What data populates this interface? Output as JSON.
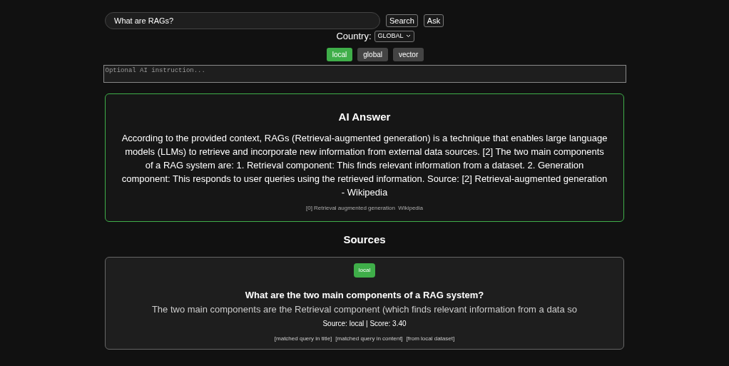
{
  "search": {
    "value": "What are RAGs?"
  },
  "buttons": [
    "Search",
    "Ask"
  ],
  "country": {
    "label": "Country:",
    "value": "GLOBAL"
  },
  "modes": [
    {
      "label": "local",
      "selected": true
    },
    {
      "label": "global",
      "selected": false
    },
    {
      "label": "vector",
      "selected": false
    }
  ],
  "instruction": {
    "placeholder": "Optional AI instruction..."
  },
  "answer": {
    "title": "AI Answer",
    "text": "According to the provided context, RAGs (Retrieval-augmented generation) is a technique that enables large language models (LLMs) to retrieve and incorporate new information from external data sources. [2] The two main components of a RAG system are: 1. Retrieval component: This finds relevant information from a dataset. 2. Generation component: This responds to user queries using the retrieved information. Source: [2] Retrieval-augmented generation - Wikipedia",
    "citation": "[0] Retrieval augmented generation  Wikipedia"
  },
  "sources_title": "Sources",
  "sources": [
    {
      "badge": "local",
      "title": "What are the two main components of a RAG system?",
      "snippet": "The two main components are the Retrieval component (which finds relevant information from a data so",
      "meta": "Source: local | Score: 3.40",
      "tags": [
        "[matched query in title]",
        "[matched query in content]",
        "[from local dataset]"
      ]
    }
  ]
}
